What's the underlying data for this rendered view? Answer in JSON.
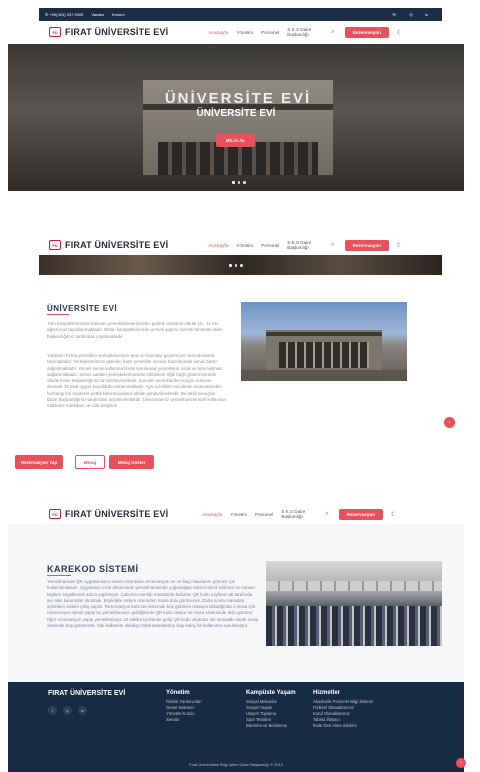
{
  "topbar": {
    "phone": "+90(424) 237 0000",
    "links": [
      "Vardan",
      "Konum"
    ],
    "social": [
      "twitter-icon",
      "instagram-icon",
      "linkedin-icon"
    ]
  },
  "nav": {
    "brand": "FIRAT ÜNİVERSİTE EVİ",
    "items": [
      "AnaSayfa",
      "Yönetim",
      "Personel"
    ],
    "multi_item": "S.K.S Daire Başkanlığı",
    "reserve": "Rezervasyon"
  },
  "hero": {
    "sign": "ÜNİVERSİTE EVİ",
    "title": "ÜNİVERSİTE EVİ",
    "button": "BİLGİ AL"
  },
  "about": {
    "title": "ÜNİVERSİTE EVİ",
    "p1": "Tüm kampüslerimizde bulunan yemekhanelerimizden günlük ortalama olarak 10 - 11 bin öğrenciniz faydalanmaktadır. Bütün kampüslerimizde yemek yapımı hizmeti tümünde daire başkanlığımız tarafından yapılmaktadır.",
    "p2": "Yüklenici Firma yemekleri yerleşkelerimize peşi ve hazırlayı geçirmeyen termoboxlarla taşımaktadır. Yerleşkelerimize getirilen hazır yemekler servise hazırlanarak servis bank'ı dağıtılmaktadır. Yemek servis kullanma fırsatı kuruluarak yemeklerin ıscak ve taze kalması sağlanmaktadır. Servis saatleri yerleşkelerimizdeki bölümlere öğle bağlı göstermektedir olarak Daire Başkanlığımızca belirlenmektedir. Sunulan yemeklerden kargın numune alınarak 72 saat uygun koşullarda saklanmaktadır. Ayrıca birlikte net alınan numunelerden herhangi biri seçilerek yetkili laboratuvarlara tahlile gönderilmektedir. Bu tahlil sonuçları Daire Başkanlığımız tarafından arşivlenmektedir. Üniversitemiz yemekhanelerinde kullanılan malzeme markaları ve özlü belgeleri",
    "buttons": [
      "Rezervasyon Yap",
      "Mesaj",
      "Mesaj Göster"
    ]
  },
  "karekod": {
    "title": "KAREKOD SİSTEMİ",
    "text": "Yemekhanede QR uygulamasını sistem üzerinden rezervasyon ve ve bag masalarını görmek için kullanılmaktadır. Uygulama covid döneminde yemekhanelerde yoğunluğun rahat kontrol edilmesi ve zaman kaybını engellemek adına yapılmıştır. Çalışma mantığı masalarda bulunan QR kodu sayfanın alt tarafında yer alan karemdan okutmak. Böylelikle sistem üzerinden masa dolu görünecek. Daha sonra masadan ayrılırken sistem çıkış yapılır. Rezervasyon kartı ise sistemde boş görünen masaya tıkladığında o masa için rezervasyon işlemi yapıp bu yemekhaneye geldiğinizde QR kodu okutur ve masa sisteminde dolu görünür. Eğer rezervasyon yapıp yemekhaneye 20 dakika içerisinde gelip QR kodu okutmaz ise otomatik olarak masa sistemde boş görünecek. Site kullanımı oldukça rahat tasarlanmış olup kolay bir kullanıma sunulmuştur."
  },
  "footer": {
    "brand": "FIRAT ÜNİVERSİTE EVİ",
    "cols": [
      {
        "title": "Yönetim",
        "items": [
          "Rektör Yardımcıları",
          "Genel Sekreter",
          "Yönetim Kurulu",
          "Senato"
        ]
      },
      {
        "title": "Kampüste Yaşam",
        "items": [
          "Sosyal Mekanlar",
          "Sosyal Yaşam",
          "Ulaşım Toplama",
          "Spor Tesisleri",
          "Barınma ve Beslenme"
        ]
      },
      {
        "title": "Hizmetler",
        "items": [
          "Akademik Personel Bilgi Sistemi",
          "Fiziksel Olanaklarımız",
          "Kurul Olanaklarımız",
          "Tabela İhtiyacı",
          "İhale Geri Alma Sistemi"
        ]
      }
    ],
    "copyright": "Fırat Üniversitesi Bilgi İşlem Daire Başkanlığı © 2010"
  },
  "colors": {
    "accent": "#e8505b",
    "navy": "#172b44"
  }
}
